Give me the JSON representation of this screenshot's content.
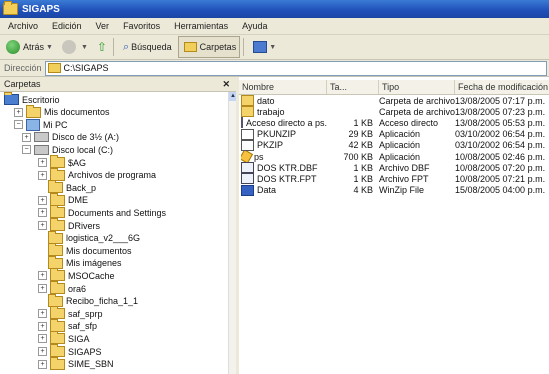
{
  "window": {
    "title": "SIGAPS"
  },
  "menu": [
    "Archivo",
    "Edición",
    "Ver",
    "Favoritos",
    "Herramientas",
    "Ayuda"
  ],
  "toolbar": {
    "back_label": "Atrás",
    "search_label": "Búsqueda",
    "folders_label": "Carpetas"
  },
  "address": {
    "label": "Dirección",
    "value": "C:\\SIGAPS"
  },
  "folders_pane": {
    "title": "Carpetas"
  },
  "tree": [
    {
      "label": "Escritorio",
      "level": 0,
      "icon": "desktop-icon",
      "expander": ""
    },
    {
      "label": "Mis documentos",
      "level": 1,
      "icon": "folder-icon",
      "expander": "+"
    },
    {
      "label": "Mi PC",
      "level": 1,
      "icon": "computer-icon",
      "expander": "−"
    },
    {
      "label": "Disco de 3½ (A:)",
      "level": 2,
      "icon": "drive-icon",
      "expander": "+"
    },
    {
      "label": "Disco local (C:)",
      "level": 2,
      "icon": "drive-icon",
      "expander": "−"
    },
    {
      "label": "$AG",
      "level": 3,
      "icon": "folder-icon",
      "expander": "+"
    },
    {
      "label": "Archivos de programa",
      "level": 3,
      "icon": "folder-icon",
      "expander": "+"
    },
    {
      "label": "Back_p",
      "level": 3,
      "icon": "folder-icon",
      "expander": ""
    },
    {
      "label": "DME",
      "level": 3,
      "icon": "folder-icon",
      "expander": "+"
    },
    {
      "label": "Documents and Settings",
      "level": 3,
      "icon": "folder-icon",
      "expander": "+"
    },
    {
      "label": "DRivers",
      "level": 3,
      "icon": "folder-icon",
      "expander": "+"
    },
    {
      "label": "logistica_v2___6G",
      "level": 3,
      "icon": "folder-icon",
      "expander": ""
    },
    {
      "label": "Mis documentos",
      "level": 3,
      "icon": "folder-icon",
      "expander": ""
    },
    {
      "label": "Mis imágenes",
      "level": 3,
      "icon": "folder-icon",
      "expander": ""
    },
    {
      "label": "MSOCache",
      "level": 3,
      "icon": "folder-icon",
      "expander": "+"
    },
    {
      "label": "ora6",
      "level": 3,
      "icon": "folder-icon",
      "expander": "+"
    },
    {
      "label": "Recibo_ficha_1_1",
      "level": 3,
      "icon": "folder-icon",
      "expander": ""
    },
    {
      "label": "saf_sprp",
      "level": 3,
      "icon": "folder-icon",
      "expander": "+"
    },
    {
      "label": "saf_sfp",
      "level": 3,
      "icon": "folder-icon",
      "expander": "+"
    },
    {
      "label": "SIGA",
      "level": 3,
      "icon": "folder-icon",
      "expander": "+"
    },
    {
      "label": "SIGAPS",
      "level": 3,
      "icon": "folder-icon",
      "expander": "+"
    },
    {
      "label": "SIME_SBN",
      "level": 3,
      "icon": "folder-icon",
      "expander": "+"
    }
  ],
  "list_headers": [
    "Nombre",
    "Ta...",
    "Tipo",
    "Fecha de modificación"
  ],
  "files": [
    {
      "name": "dato",
      "size": "",
      "type": "Carpeta de archivos",
      "modified": "13/08/2005 07:17 p.m.",
      "icon": "i-folder"
    },
    {
      "name": "trabajo",
      "size": "",
      "type": "Carpeta de archivos",
      "modified": "13/08/2005 07:23 p.m.",
      "icon": "i-folder"
    },
    {
      "name": "Acceso directo a ps.exe",
      "size": "1 KB",
      "type": "Acceso directo",
      "modified": "13/08/2005 05:53 p.m.",
      "icon": "i-short"
    },
    {
      "name": "PKUNZIP",
      "size": "29 KB",
      "type": "Aplicación",
      "modified": "03/10/2002 06:54 p.m.",
      "icon": "i-app"
    },
    {
      "name": "PKZIP",
      "size": "42 KB",
      "type": "Aplicación",
      "modified": "03/10/2002 06:54 p.m.",
      "icon": "i-app"
    },
    {
      "name": "ps",
      "size": "700 KB",
      "type": "Aplicación",
      "modified": "10/08/2005 02:46 p.m.",
      "icon": "i-app2"
    },
    {
      "name": "DOS KTR.DBF",
      "size": "1 KB",
      "type": "Archivo DBF",
      "modified": "10/08/2005 07:20 p.m.",
      "icon": "i-cfg"
    },
    {
      "name": "DOS KTR.FPT",
      "size": "1 KB",
      "type": "Archivo FPT",
      "modified": "10/08/2005 07:21 p.m.",
      "icon": "i-cfg"
    },
    {
      "name": "Data",
      "size": "4 KB",
      "type": "WinZip File",
      "modified": "15/08/2005 04:00 p.m.",
      "icon": "i-zip"
    }
  ]
}
